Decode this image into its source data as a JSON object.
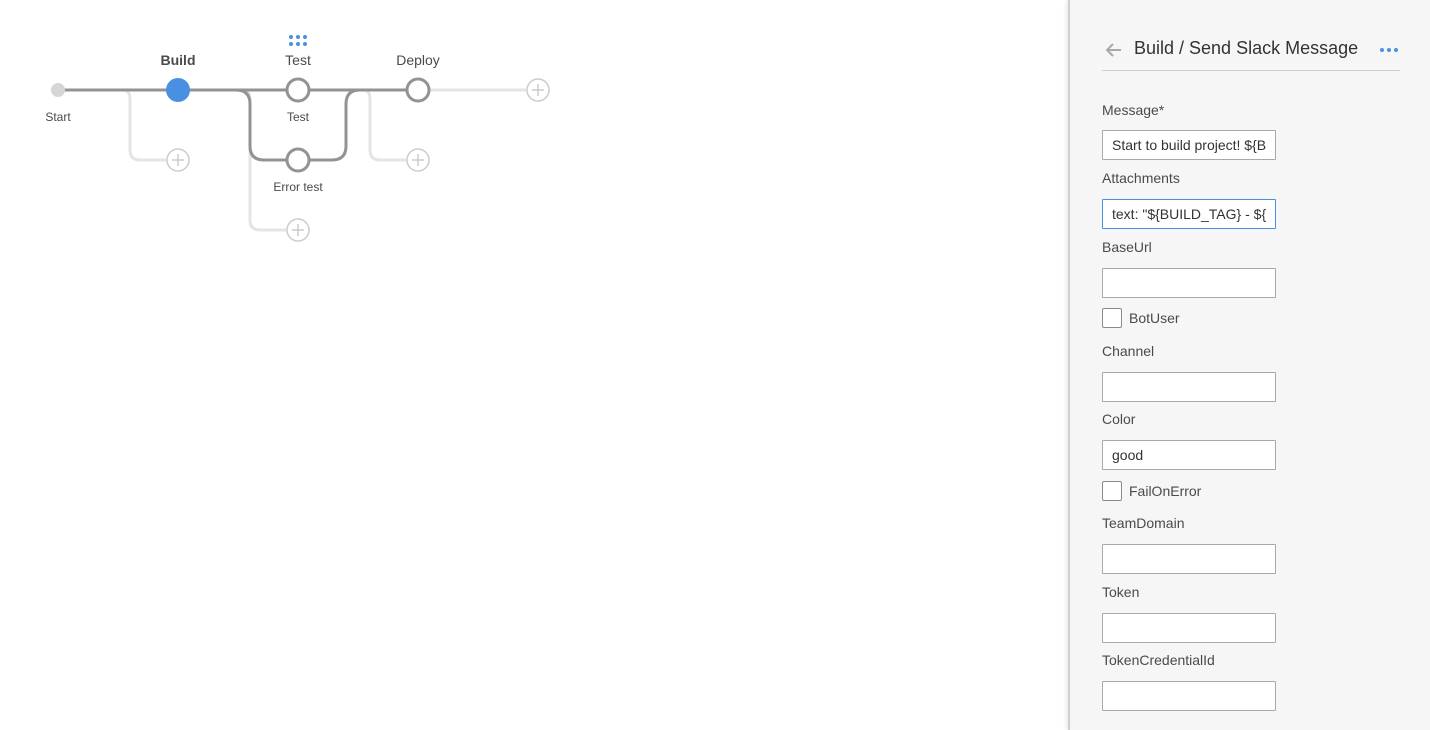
{
  "pipeline": {
    "start_label": "Start",
    "stages": [
      {
        "name": "Build",
        "active": true
      },
      {
        "name": "Test",
        "active": false
      },
      {
        "name": "Deploy",
        "active": false
      }
    ],
    "parallel_nodes": {
      "test_branch_1": "Test",
      "test_branch_2": "Error test"
    },
    "colors": {
      "active_node": "#4a90e2",
      "line": "#949393",
      "placeholder_line": "#e4e4e4",
      "add_icon": "#cccccc"
    }
  },
  "sheet": {
    "title": "Build / Send Slack Message",
    "fields": {
      "message": {
        "label": "Message*",
        "value": "Start to build project! ${BUILD_TAG}"
      },
      "attachments": {
        "label": "Attachments",
        "value": "text: \"${BUILD_TAG} - ${BUILD_URL}\""
      },
      "baseurl": {
        "label": "BaseUrl",
        "value": ""
      },
      "botuser": {
        "label": "BotUser",
        "checked": false
      },
      "channel": {
        "label": "Channel",
        "value": ""
      },
      "color": {
        "label": "Color",
        "value": "good"
      },
      "failonerror": {
        "label": "FailOnError",
        "checked": false
      },
      "teamdomain": {
        "label": "TeamDomain",
        "value": ""
      },
      "token": {
        "label": "Token",
        "value": ""
      },
      "tokencredentialid": {
        "label": "TokenCredentialId",
        "value": ""
      }
    }
  }
}
